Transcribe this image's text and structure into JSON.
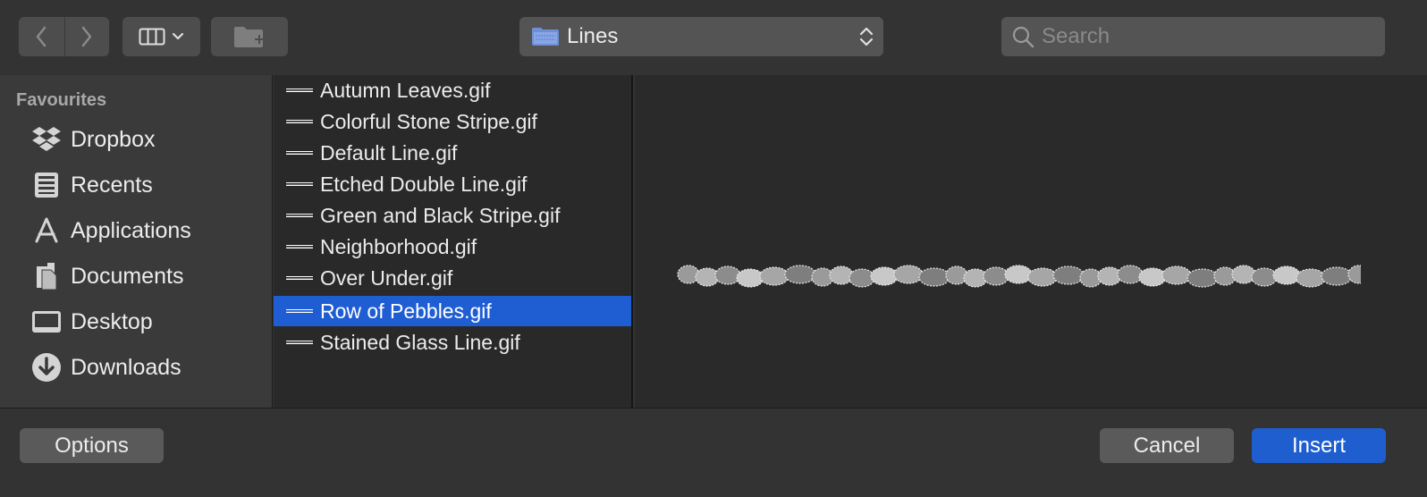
{
  "toolbar": {
    "location_label": "Lines",
    "search_placeholder": "Search"
  },
  "sidebar": {
    "heading": "Favourites",
    "items": [
      {
        "label": "Dropbox",
        "icon": "dropbox-icon"
      },
      {
        "label": "Recents",
        "icon": "recents-icon"
      },
      {
        "label": "Applications",
        "icon": "applications-icon"
      },
      {
        "label": "Documents",
        "icon": "documents-icon"
      },
      {
        "label": "Desktop",
        "icon": "desktop-icon"
      },
      {
        "label": "Downloads",
        "icon": "downloads-icon"
      }
    ]
  },
  "files": [
    {
      "name": "Autumn Leaves.gif",
      "selected": false
    },
    {
      "name": "Colorful Stone Stripe.gif",
      "selected": false
    },
    {
      "name": "Default Line.gif",
      "selected": false
    },
    {
      "name": "Etched Double Line.gif",
      "selected": false
    },
    {
      "name": "Green and Black Stripe.gif",
      "selected": false
    },
    {
      "name": "Neighborhood.gif",
      "selected": false
    },
    {
      "name": "Over Under.gif",
      "selected": false
    },
    {
      "name": "Row of Pebbles.gif",
      "selected": true
    },
    {
      "name": "Stained Glass Line.gif",
      "selected": false
    }
  ],
  "buttons": {
    "options": "Options",
    "cancel": "Cancel",
    "insert": "Insert"
  },
  "colors": {
    "accent": "#1f5ecf",
    "selection": "#1f5dd2"
  }
}
